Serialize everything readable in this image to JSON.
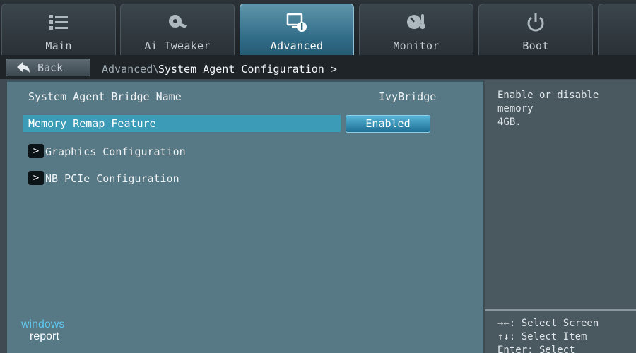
{
  "tabs": [
    {
      "label": "Main",
      "icon": "list-icon",
      "active": false
    },
    {
      "label": "Ai Tweaker",
      "icon": "fan-icon",
      "active": false
    },
    {
      "label": "Advanced",
      "icon": "monitor-info-icon",
      "active": true
    },
    {
      "label": "Monitor",
      "icon": "gauge-thermometer-icon",
      "active": false
    },
    {
      "label": "Boot",
      "icon": "power-icon",
      "active": false
    }
  ],
  "breadcrumb": {
    "back_label": "Back",
    "prefix": "Advanced\\",
    "current": "System Agent Configuration >"
  },
  "settings": {
    "bridge_name_label": "System Agent Bridge Name",
    "bridge_name_value": "IvyBridge",
    "memory_remap_label": "Memory Remap Feature",
    "memory_remap_value": "Enabled",
    "submenus": [
      {
        "arrow": ">",
        "label": "Graphics Configuration"
      },
      {
        "arrow": ">",
        "label": "NB PCIe Configuration"
      }
    ]
  },
  "help": {
    "description_line1": "Enable or disable memory",
    "description_line2": "4GB.",
    "keys": [
      "→←: Select Screen",
      "↑↓: Select Item",
      "Enter: Select"
    ]
  },
  "watermark": {
    "line1": "windows",
    "line2": "report"
  },
  "colors": {
    "accent": "#3c9bb6",
    "panel": "#577885",
    "active_tab": "#2f6a86"
  }
}
